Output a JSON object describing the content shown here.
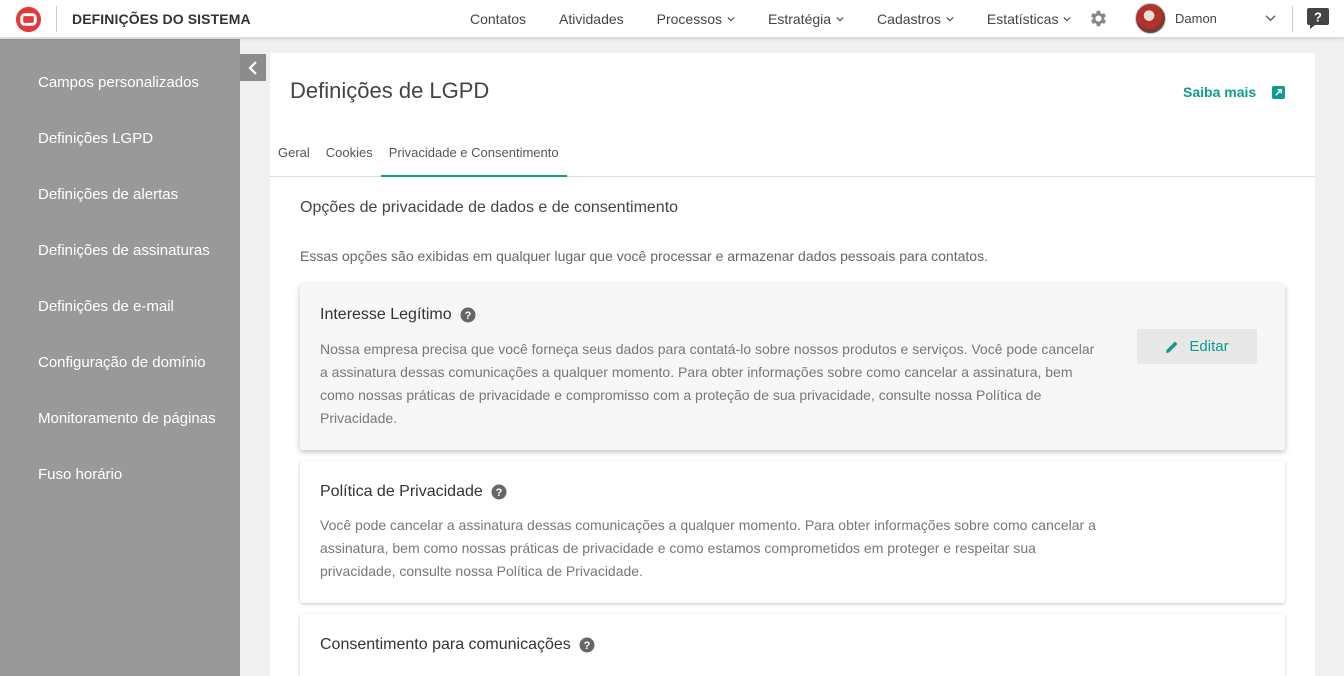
{
  "header": {
    "app_title": "DEFINIÇÕES DO SISTEMA",
    "nav": [
      {
        "label": "Contatos",
        "has_dropdown": false
      },
      {
        "label": "Atividades",
        "has_dropdown": false
      },
      {
        "label": "Processos",
        "has_dropdown": true
      },
      {
        "label": "Estratégia",
        "has_dropdown": true
      },
      {
        "label": "Cadastros",
        "has_dropdown": true
      },
      {
        "label": "Estatísticas",
        "has_dropdown": true
      }
    ],
    "user_name": "Damon",
    "icons": {
      "logo": "brand-logo",
      "settings": "gear-icon",
      "help": "help-icon"
    }
  },
  "sidebar": {
    "items": [
      "Campos personalizados",
      "Definições LGPD",
      "Definições de alertas",
      "Definições de assinaturas",
      "Definições de e-mail",
      "Configuração de domínio",
      "Monitoramento de páginas",
      "Fuso horário"
    ]
  },
  "main": {
    "title": "Definições de LGPD",
    "saiba_mais": "Saiba mais",
    "tabs": [
      {
        "label": "Geral",
        "active": false
      },
      {
        "label": "Cookies",
        "active": false
      },
      {
        "label": "Privacidade e Consentimento",
        "active": true
      }
    ],
    "section_title": "Opções de privacidade de dados e de consentimento",
    "section_desc": "Essas opções são exibidas em qualquer lugar que você processar e armazenar dados pessoais para contatos.",
    "edit_label": "Editar",
    "cards": [
      {
        "title": "Interesse Legítimo",
        "text": "Nossa empresa precisa que você forneça seus dados para contatá-lo sobre nossos produtos e serviços. Você pode cancelar a assinatura dessas comunicações a qualquer momento. Para obter informações sobre como cancelar a assinatura, bem como nossas práticas de privacidade e compromisso com a proteção de sua privacidade, consulte nossa Política de Privacidade."
      },
      {
        "title": "Política de Privacidade",
        "text": "Você pode cancelar a assinatura dessas comunicações a qualquer momento. Para obter informações sobre como cancelar a assinatura, bem como nossas práticas de privacidade e como estamos comprometidos em proteger e respeitar sua privacidade, consulte nossa Política de Privacidade."
      },
      {
        "title": "Consentimento para comunicações",
        "text": ""
      }
    ]
  },
  "colors": {
    "accent": "#0f9b8e",
    "sidebar_bg": "#999999",
    "brand_red": "#e03a3a"
  }
}
